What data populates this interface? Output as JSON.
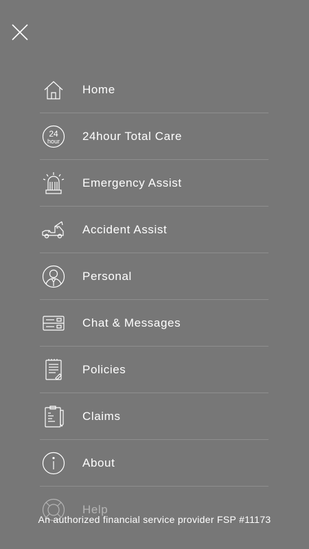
{
  "menu": {
    "close_icon": "close-icon",
    "items": [
      {
        "label": "Home",
        "icon": "home-icon"
      },
      {
        "label": "24hour Total Care",
        "icon": "24hour-icon"
      },
      {
        "label": "Emergency Assist",
        "icon": "siren-icon"
      },
      {
        "label": "Accident Assist",
        "icon": "tow-truck-icon"
      },
      {
        "label": "Personal",
        "icon": "person-icon"
      },
      {
        "label": "Chat & Messages",
        "icon": "messages-icon"
      },
      {
        "label": "Policies",
        "icon": "policy-document-icon"
      },
      {
        "label": "Claims",
        "icon": "clipboard-icon"
      },
      {
        "label": "About",
        "icon": "info-icon"
      },
      {
        "label": "Help",
        "icon": "lifebuoy-icon"
      }
    ],
    "icon_24_text": "24",
    "icon_hour_text": "hour"
  },
  "footer": {
    "text": "An authorized financial service provider FSP #11173"
  },
  "colors": {
    "background": "#777777",
    "text": "#ffffff"
  }
}
